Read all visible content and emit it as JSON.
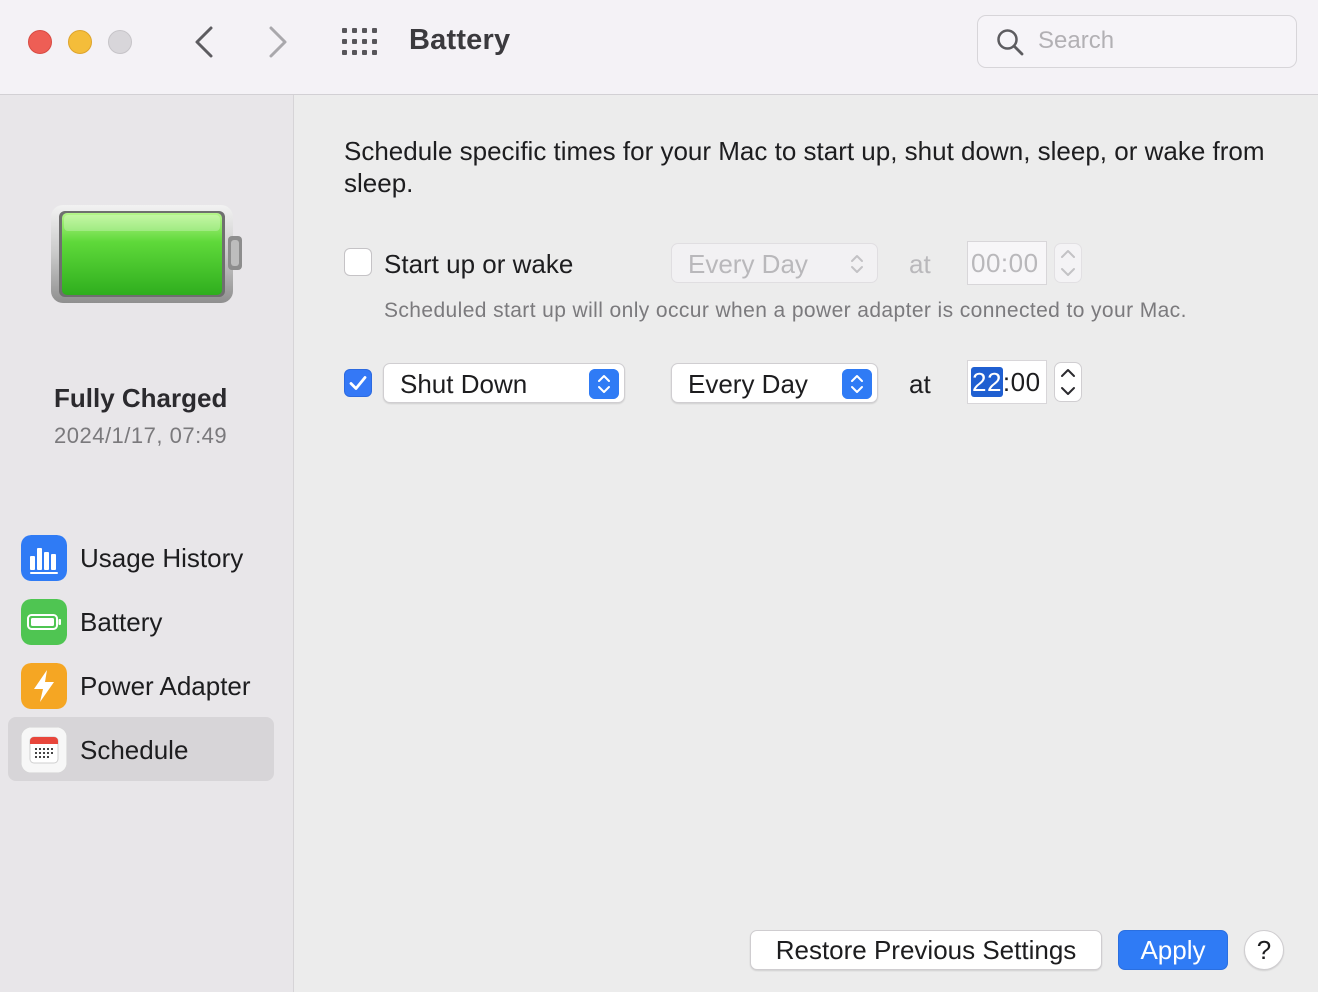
{
  "window": {
    "title": "Battery",
    "search": {
      "placeholder": "Search",
      "value": ""
    }
  },
  "sidebar": {
    "status": {
      "title": "Fully Charged",
      "date": "2024/1/17, 07:49"
    },
    "items": [
      {
        "label": "Usage History",
        "icon": "bar-chart-icon",
        "color": "#2f7bf5"
      },
      {
        "label": "Battery",
        "icon": "battery-icon",
        "color": "#4fc552"
      },
      {
        "label": "Power Adapter",
        "icon": "lightning-icon",
        "color": "#f5a623"
      },
      {
        "label": "Schedule",
        "icon": "calendar-icon",
        "color": "#ffffff",
        "selected": true
      }
    ]
  },
  "schedule": {
    "description": "Schedule specific times for your Mac to start up, shut down, sleep, or wake from sleep.",
    "startup": {
      "checked": false,
      "label": "Start up or wake",
      "frequency": "Every Day",
      "at_label": "at",
      "time": "00:00",
      "note": "Scheduled start up will only occur when a power adapter is connected to your Mac."
    },
    "shutdown": {
      "checked": true,
      "action": "Shut Down",
      "frequency": "Every Day",
      "at_label": "at",
      "time_hours": "22",
      "time_sep": ":",
      "time_minutes": "00"
    }
  },
  "buttons": {
    "restore": "Restore Previous Settings",
    "apply": "Apply",
    "help": "?"
  },
  "colors": {
    "accent": "#2f7bf5",
    "battery_fill": "#4fc552"
  }
}
